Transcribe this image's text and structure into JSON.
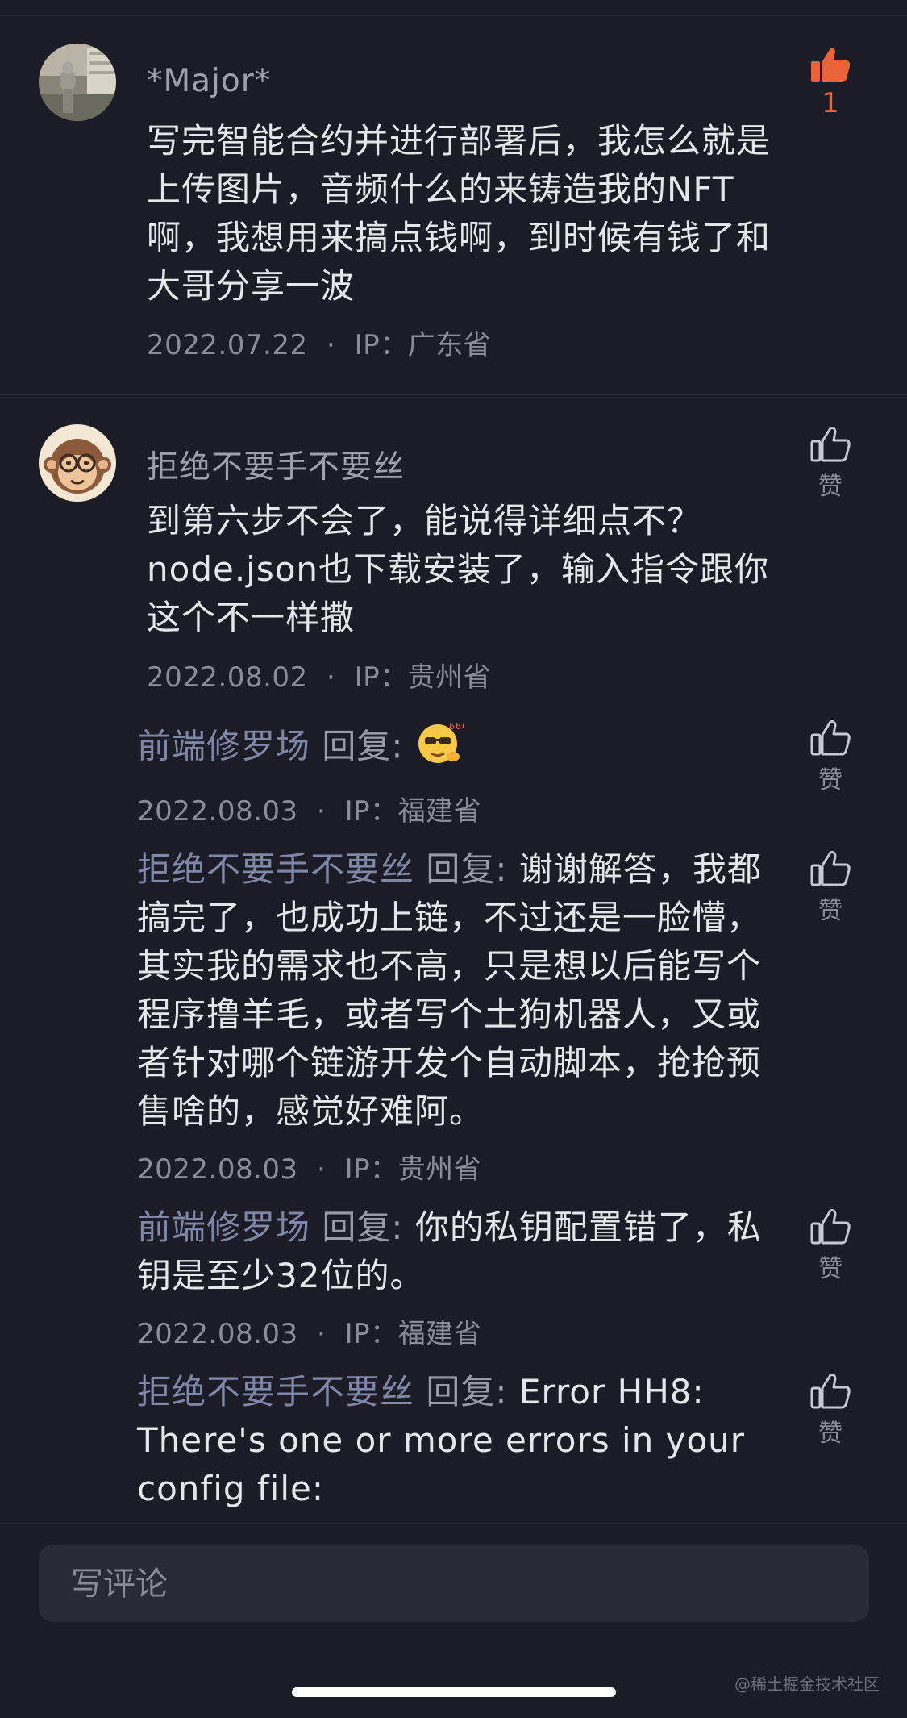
{
  "comments": [
    {
      "author": "*Major*",
      "text": "写完智能合约并进行部署后，我怎么就是上传图片，音频什么的来铸造我的NFT啊，我想用来搞点钱啊，到时候有钱了和大哥分享一波",
      "date": "2022.07.22",
      "ip": "IP：广东省",
      "likes": "1"
    },
    {
      "author": "拒绝不要手不要丝",
      "text": "到第六步不会了，能说得详细点不？node.json也下载安装了，输入指令跟你这个不一样撒",
      "date": "2022.08.02",
      "ip": "IP：贵州省",
      "like_label": "赞"
    }
  ],
  "replies": [
    {
      "author": "前端修罗场",
      "reply_word": "回复:",
      "text": "",
      "emoji": "666-sunglasses-emoji",
      "date": "2022.08.03",
      "ip": "IP：福建省",
      "like_label": "赞"
    },
    {
      "author": "拒绝不要手不要丝",
      "reply_word": "回复:",
      "text": "谢谢解答，我都搞完了，也成功上链，不过还是一脸懵，其实我的需求也不高，只是想以后能写个程序撸羊毛，或者写个土狗机器人，又或者针对哪个链游开发个自动脚本，抢抢预售啥的，感觉好难阿。",
      "date": "2022.08.03",
      "ip": "IP：贵州省",
      "like_label": "赞"
    },
    {
      "author": "前端修罗场",
      "reply_word": "回复:",
      "text": "你的私钥配置错了，私钥是至少32位的。",
      "date": "2022.08.03",
      "ip": "IP：福建省",
      "like_label": "赞"
    },
    {
      "author": "拒绝不要手不要丝",
      "reply_word": "回复:",
      "text": "Error HH8: There's one or more errors in your config file:",
      "like_label": "赞"
    }
  ],
  "composer": {
    "placeholder": "写评论"
  },
  "meta_separator": "·",
  "watermark": "@稀土掘金技术社区",
  "colors": {
    "background": "#1c1c26",
    "liked": "#e9643b",
    "reply_name": "#7f86a7"
  }
}
